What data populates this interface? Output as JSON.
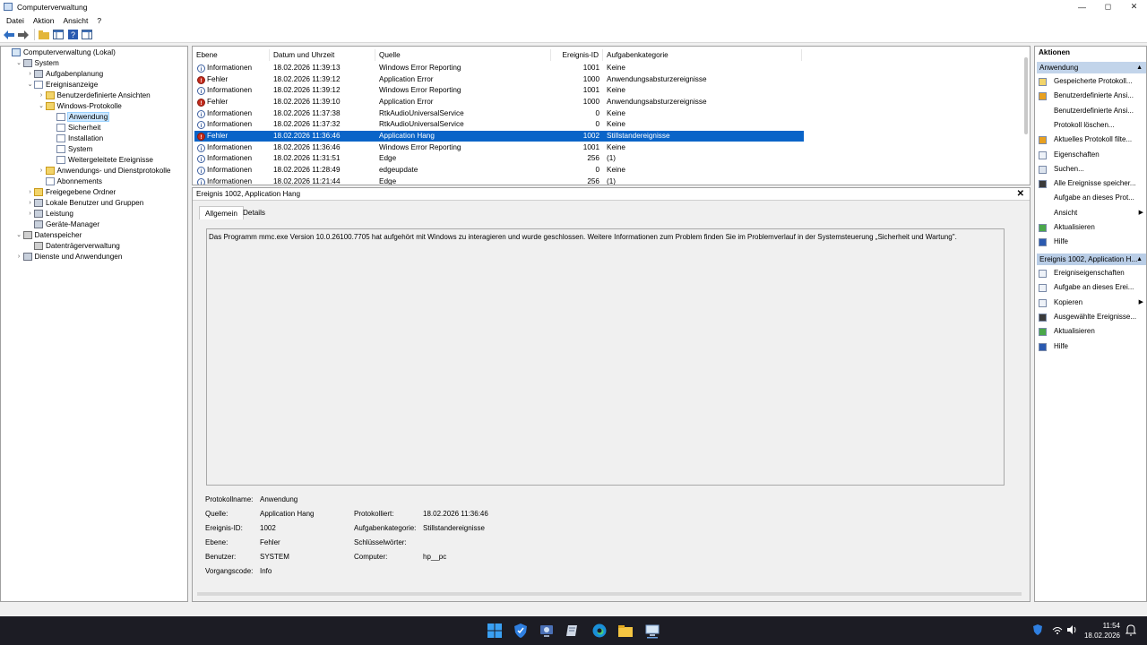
{
  "window": {
    "title": "Computerverwaltung",
    "controls": [
      "—",
      "◻",
      "✕"
    ]
  },
  "menu": [
    "Datei",
    "Aktion",
    "Ansicht",
    "?"
  ],
  "tree": [
    {
      "label": "Computerverwaltung (Lokal)",
      "indent": 0,
      "tw": "",
      "icon": "comp"
    },
    {
      "label": "System",
      "indent": 1,
      "tw": "⌄",
      "icon": "gear"
    },
    {
      "label": "Aufgabenplanung",
      "indent": 2,
      "tw": "›",
      "icon": "gear"
    },
    {
      "label": "Ereignisanzeige",
      "indent": 2,
      "tw": "⌄",
      "icon": "log"
    },
    {
      "label": "Benutzerdefinierte Ansichten",
      "indent": 3,
      "tw": "›",
      "icon": "folder"
    },
    {
      "label": "Windows-Protokolle",
      "indent": 3,
      "tw": "⌄",
      "icon": "folder"
    },
    {
      "label": "Anwendung",
      "indent": 4,
      "tw": "",
      "icon": "log",
      "selected": true
    },
    {
      "label": "Sicherheit",
      "indent": 4,
      "tw": "",
      "icon": "log"
    },
    {
      "label": "Installation",
      "indent": 4,
      "tw": "",
      "icon": "log"
    },
    {
      "label": "System",
      "indent": 4,
      "tw": "",
      "icon": "log"
    },
    {
      "label": "Weitergeleitete Ereignisse",
      "indent": 4,
      "tw": "",
      "icon": "log"
    },
    {
      "label": "Anwendungs- und Dienstprotokolle",
      "indent": 3,
      "tw": "›",
      "icon": "folder"
    },
    {
      "label": "Abonnements",
      "indent": 3,
      "tw": "",
      "icon": "log"
    },
    {
      "label": "Freigegebene Ordner",
      "indent": 2,
      "tw": "›",
      "icon": "folder"
    },
    {
      "label": "Lokale Benutzer und Gruppen",
      "indent": 2,
      "tw": "›",
      "icon": "gear"
    },
    {
      "label": "Leistung",
      "indent": 2,
      "tw": "›",
      "icon": "gear"
    },
    {
      "label": "Geräte-Manager",
      "indent": 2,
      "tw": "",
      "icon": "gear"
    },
    {
      "label": "Datenspeicher",
      "indent": 1,
      "tw": "⌄",
      "icon": "disk"
    },
    {
      "label": "Datenträgerverwaltung",
      "indent": 2,
      "tw": "",
      "icon": "disk"
    },
    {
      "label": "Dienste und Anwendungen",
      "indent": 1,
      "tw": "›",
      "icon": "gear"
    }
  ],
  "columns": [
    "Ebene",
    "Datum und Uhrzeit",
    "Quelle",
    "Ereignis-ID",
    "Aufgabenkategorie"
  ],
  "events": [
    {
      "level": "Informationen",
      "type": "info",
      "date": "18.02.2026 11:39:13",
      "source": "Windows Error Reporting",
      "id": "1001",
      "category": "Keine"
    },
    {
      "level": "Fehler",
      "type": "err",
      "date": "18.02.2026 11:39:12",
      "source": "Application Error",
      "id": "1000",
      "category": "Anwendungsabsturzereignisse"
    },
    {
      "level": "Informationen",
      "type": "info",
      "date": "18.02.2026 11:39:12",
      "source": "Windows Error Reporting",
      "id": "1001",
      "category": "Keine"
    },
    {
      "level": "Fehler",
      "type": "err",
      "date": "18.02.2026 11:39:10",
      "source": "Application Error",
      "id": "1000",
      "category": "Anwendungsabsturzereignisse"
    },
    {
      "level": "Informationen",
      "type": "info",
      "date": "18.02.2026 11:37:38",
      "source": "RtkAudioUniversalService",
      "id": "0",
      "category": "Keine"
    },
    {
      "level": "Informationen",
      "type": "info",
      "date": "18.02.2026 11:37:32",
      "source": "RtkAudioUniversalService",
      "id": "0",
      "category": "Keine"
    },
    {
      "level": "Fehler",
      "type": "err",
      "date": "18.02.2026 11:36:46",
      "source": "Application Hang",
      "id": "1002",
      "category": "Stillstandereignisse",
      "selected": true
    },
    {
      "level": "Informationen",
      "type": "info",
      "date": "18.02.2026 11:36:46",
      "source": "Windows Error Reporting",
      "id": "1001",
      "category": "Keine"
    },
    {
      "level": "Informationen",
      "type": "info",
      "date": "18.02.2026 11:31:51",
      "source": "Edge",
      "id": "256",
      "category": "(1)"
    },
    {
      "level": "Informationen",
      "type": "info",
      "date": "18.02.2026 11:28:49",
      "source": "edgeupdate",
      "id": "0",
      "category": "Keine"
    },
    {
      "level": "Informationen",
      "type": "info",
      "date": "18.02.2026 11:21:44",
      "source": "Edge",
      "id": "256",
      "category": "(1)"
    }
  ],
  "detail": {
    "header": "Ereignis 1002, Application Hang",
    "tabs": [
      "Allgemein",
      "Details"
    ],
    "description": "Das Programm mmc.exe Version 10.0.26100.7705 hat aufgehört mit Windows zu interagieren und wurde geschlossen. Weitere Informationen zum Problem finden Sie im Problemverlauf in der Systemsteuerung „Sicherheit und Wartung\".",
    "props": {
      "protokollname_label": "Protokollname:",
      "protokollname": "Anwendung",
      "quelle_label": "Quelle:",
      "quelle": "Application Hang",
      "protokolliert_label": "Protokolliert:",
      "protokolliert": "18.02.2026 11:36:46",
      "ereignisid_label": "Ereignis-ID:",
      "ereignisid": "1002",
      "aufgabenkategorie_label": "Aufgabenkategorie:",
      "aufgabenkategorie": "Stillstandereignisse",
      "ebene_label": "Ebene:",
      "ebene": "Fehler",
      "schluessel_label": "Schlüsselwörter:",
      "benutzer_label": "Benutzer:",
      "benutzer": "SYSTEM",
      "computer_label": "Computer:",
      "computer": "hp__pc",
      "vorgangscode_label": "Vorgangscode:",
      "vorgangscode": "Info"
    }
  },
  "actions": {
    "title": "Aktionen",
    "section1": "Anwendung",
    "items1": [
      {
        "label": "Gespeicherte Protokoll...",
        "icon": "folder"
      },
      {
        "label": "Benutzerdefinierte Ansi...",
        "icon": "filter"
      },
      {
        "label": "Benutzerdefinierte Ansi...",
        "icon": ""
      },
      {
        "label": "Protokoll löschen...",
        "icon": ""
      },
      {
        "label": "Aktuelles Protokoll filte...",
        "icon": "filter"
      },
      {
        "label": "Eigenschaften",
        "icon": "props"
      },
      {
        "label": "Suchen...",
        "icon": "find"
      },
      {
        "label": "Alle Ereignisse speicher...",
        "icon": "save"
      },
      {
        "label": "Aufgabe an dieses Prot...",
        "icon": ""
      },
      {
        "label": "Ansicht",
        "icon": "",
        "sub": true
      },
      {
        "label": "Aktualisieren",
        "icon": "refresh"
      },
      {
        "label": "Hilfe",
        "icon": "help"
      }
    ],
    "section2": "Ereignis 1002, Application H...",
    "items2": [
      {
        "label": "Ereigniseigenschaften",
        "icon": "props"
      },
      {
        "label": "Aufgabe an dieses Erei...",
        "icon": "task"
      },
      {
        "label": "Kopieren",
        "icon": "copy",
        "sub": true
      },
      {
        "label": "Ausgewählte Ereignisse...",
        "icon": "save"
      },
      {
        "label": "Aktualisieren",
        "icon": "refresh"
      },
      {
        "label": "Hilfe",
        "icon": "help"
      }
    ]
  },
  "taskbar": {
    "time": "11:54",
    "date": "18.02.2026"
  }
}
